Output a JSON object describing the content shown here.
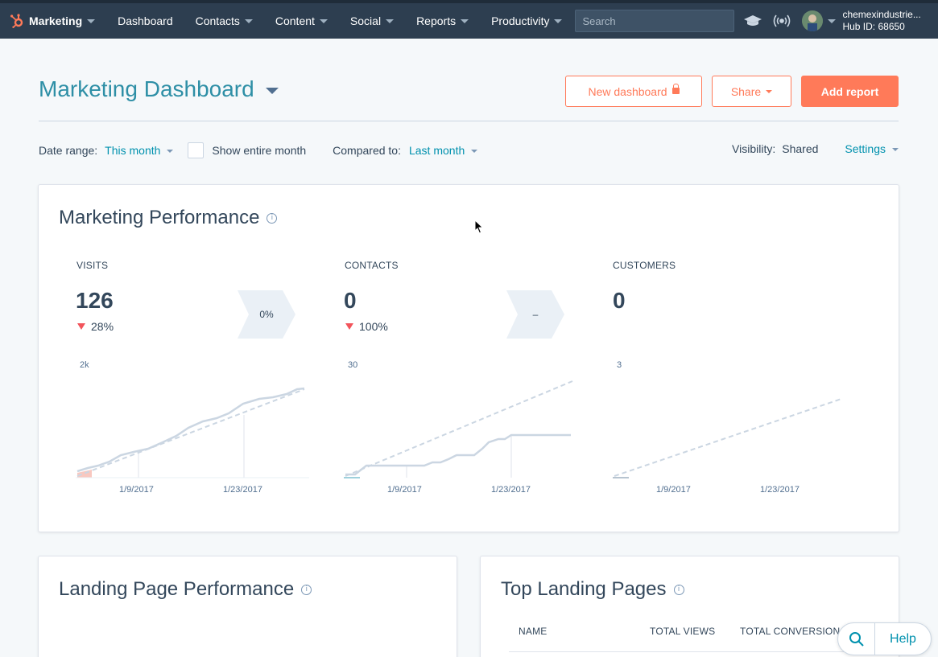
{
  "nav": {
    "app_label": "Marketing",
    "items": [
      "Dashboard",
      "Contacts",
      "Content",
      "Social",
      "Reports",
      "Productivity"
    ],
    "search_placeholder": "Search",
    "account_name": "chemexindustrie...",
    "hub_id": "Hub ID: 68650",
    "icons": [
      "academy-icon",
      "notifications-icon"
    ]
  },
  "header": {
    "title": "Marketing Dashboard",
    "new_dashboard": "New dashboard",
    "share": "Share",
    "add_report": "Add report"
  },
  "filters": {
    "date_range_label": "Date range:",
    "date_range_value": "This month",
    "show_entire_month": "Show entire month",
    "compared_label": "Compared to:",
    "compared_value": "Last month",
    "visibility_label": "Visibility:",
    "visibility_value": "Shared",
    "settings": "Settings"
  },
  "performance": {
    "title": "Marketing Performance",
    "metrics": [
      {
        "label": "VISITS",
        "value": "126",
        "change": "28%",
        "axis_max": "2k",
        "dates": [
          "1/9/2017",
          "1/23/2017"
        ]
      },
      {
        "label": "CONTACTS",
        "value": "0",
        "change": "100%",
        "axis_max": "30",
        "dates": [
          "1/9/2017",
          "1/23/2017"
        ]
      },
      {
        "label": "CUSTOMERS",
        "value": "0",
        "axis_max": "3",
        "dates": [
          "1/9/2017",
          "1/23/2017"
        ]
      }
    ],
    "conversions": [
      "0%",
      "–"
    ]
  },
  "landing": {
    "title": "Landing Page Performance"
  },
  "top_pages": {
    "title": "Top Landing Pages",
    "columns": [
      "NAME",
      "TOTAL VIEWS",
      "TOTAL CONVERSION R"
    ]
  },
  "help": {
    "label": "Help"
  },
  "colors": {
    "nav_bg": "#2d3e50",
    "accent_orange": "#ff7a59",
    "title_teal": "#2e8fa6",
    "link_blue": "#0091ae",
    "down_red": "#f2545b"
  }
}
